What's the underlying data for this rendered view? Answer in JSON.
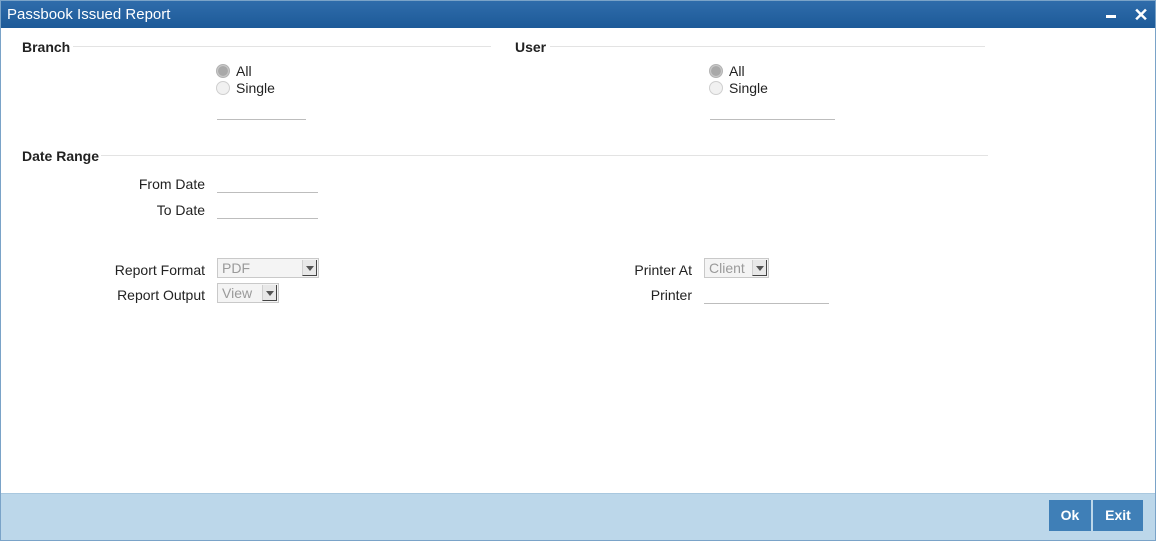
{
  "window": {
    "title": "Passbook Issued Report"
  },
  "branch": {
    "section_label": "Branch",
    "options": [
      {
        "label": "All",
        "selected": true
      },
      {
        "label": "Single",
        "selected": false
      }
    ],
    "input_value": ""
  },
  "user": {
    "section_label": "User",
    "options": [
      {
        "label": "All",
        "selected": true
      },
      {
        "label": "Single",
        "selected": false
      }
    ],
    "input_value": ""
  },
  "date_range": {
    "section_label": "Date Range",
    "from_label": "From Date",
    "from_value": "",
    "to_label": "To Date",
    "to_value": ""
  },
  "report": {
    "format_label": "Report Format",
    "format_value": "PDF",
    "output_label": "Report Output",
    "output_value": "View",
    "printer_at_label": "Printer At",
    "printer_at_value": "Client",
    "printer_label": "Printer",
    "printer_value": ""
  },
  "footer": {
    "ok_label": "Ok",
    "exit_label": "Exit"
  },
  "colors": {
    "titlebar": "#1d5a98",
    "footer": "#bcd7ea",
    "button": "#3f7fb7"
  }
}
